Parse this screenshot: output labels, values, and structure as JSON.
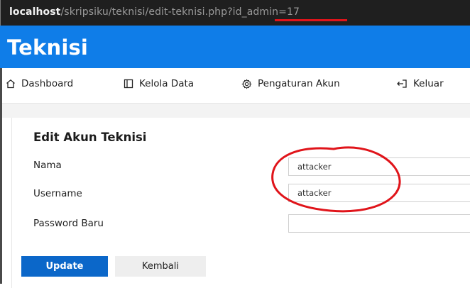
{
  "browser": {
    "url_host": "localhost",
    "url_path": "/skripsiku/teknisi/edit-teknisi.php?id_admin=17"
  },
  "app": {
    "brand": "Teknisi"
  },
  "nav": {
    "items": [
      {
        "label": "Dashboard",
        "icon": "home-icon"
      },
      {
        "label": "Kelola Data",
        "icon": "layout-icon"
      },
      {
        "label": "Pengaturan Akun",
        "icon": "gear-icon"
      },
      {
        "label": "Keluar",
        "icon": "logout-icon"
      }
    ]
  },
  "form": {
    "title": "Edit Akun Teknisi",
    "fields": [
      {
        "label": "Nama",
        "value": "attacker"
      },
      {
        "label": "Username",
        "value": "attacker"
      },
      {
        "label": "Password Baru",
        "value": ""
      }
    ],
    "update_label": "Update",
    "back_label": "Kembali"
  },
  "colors": {
    "header_bg": "#0f7de8",
    "primary_button": "#0b67c9",
    "annotation_red": "#e0141a"
  }
}
